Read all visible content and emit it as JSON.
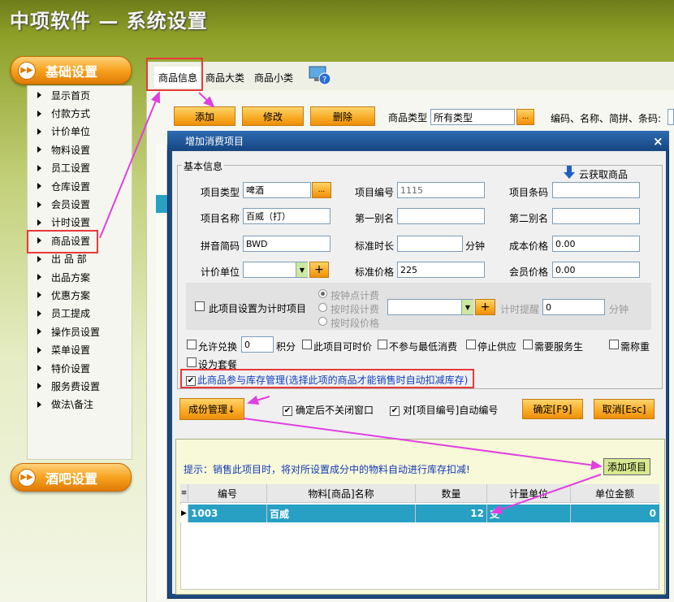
{
  "app": {
    "title": "中项软件 — 系统设置"
  },
  "sidebar": {
    "basic_title": "基础设置",
    "bar_title": "酒吧设置",
    "items": [
      "显示首页",
      "付款方式",
      "计价单位",
      "物料设置",
      "员工设置",
      "仓库设置",
      "会员设置",
      "计时设置",
      "商品设置",
      "出 品 部",
      "出品方案",
      "优惠方案",
      "员工提成",
      "操作员设置",
      "菜单设置",
      "特价设置",
      "服务费设置",
      "做法\\备注"
    ]
  },
  "tabs": [
    "商品信息",
    "商品大类",
    "商品小类"
  ],
  "toolbar": {
    "add": "添加",
    "edit": "修改",
    "delete": "删除",
    "category_label": "商品类型",
    "category_value": "所有类型",
    "ellipsis": "...",
    "search_label": "编码、名称、简拼、条码:"
  },
  "dialog": {
    "title": "增加消费项目",
    "close": "×",
    "group": "基本信息",
    "cloud": "云获取商品",
    "type_label": "项目类型",
    "type_value": "啤酒",
    "code_label": "项目编号",
    "code_value": "1115",
    "barcode_label": "项目条码",
    "barcode_value": "",
    "name_label": "项目名称",
    "name_value": "百威（打）",
    "alias1_label": "第一别名",
    "alias1_value": "",
    "alias2_label": "第二别名",
    "alias2_value": "",
    "pinyin_label": "拼音简码",
    "pinyin_value": "BWD",
    "duration_label": "标准时长",
    "duration_value": "",
    "minute": "分钟",
    "cost_label": "成本价格",
    "cost_value": "0.00",
    "unit_label": "计价单位",
    "unit_value": "",
    "price_label": "标准价格",
    "price_value": "225",
    "member_label": "会员价格",
    "member_value": "0.00",
    "timing": {
      "set_label": "此项目设置为计时项目",
      "by_minute": "按钟点计费",
      "by_period": "按时段计费",
      "by_period_price": "按时段价格",
      "remind": "计时提醒",
      "remind_value": "0",
      "minute": "分钟"
    },
    "options": {
      "exchange": "允许兑换",
      "exchange_value": "0",
      "points": "积分",
      "price_editable": "此项目可时价",
      "no_min": "不参与最低消费",
      "stop": "停止供应",
      "need_service": "需要服务生",
      "need_weigh": "需称重",
      "set_package": "设为套餐",
      "inventory": "此商品参与库存管理(选择此项的商品才能销售时自动扣减库存)"
    },
    "component_btn": "成份管理↓",
    "keep_open": "确定后不关闭窗口",
    "auto_code": "对[项目编号]自动编号",
    "ok": "确定[F9]",
    "cancel": "取消[Esc]",
    "hint": "提示：销售此项目时，将对所设置成分中的物料自动进行库存扣减!",
    "add_item": "添加项目",
    "grid": {
      "columns": [
        "编号",
        "物料[商品]名称",
        "数量",
        "计量单位",
        "单位金额"
      ],
      "rows": [
        {
          "code": "1003",
          "name": "百威",
          "qty": "12",
          "unit": "支",
          "amount": "0"
        }
      ]
    }
  },
  "colors": {
    "accent": "#f7a21f",
    "highlight": "#e8393a",
    "arrow": "#e040e0",
    "row": "#27a0c4"
  }
}
